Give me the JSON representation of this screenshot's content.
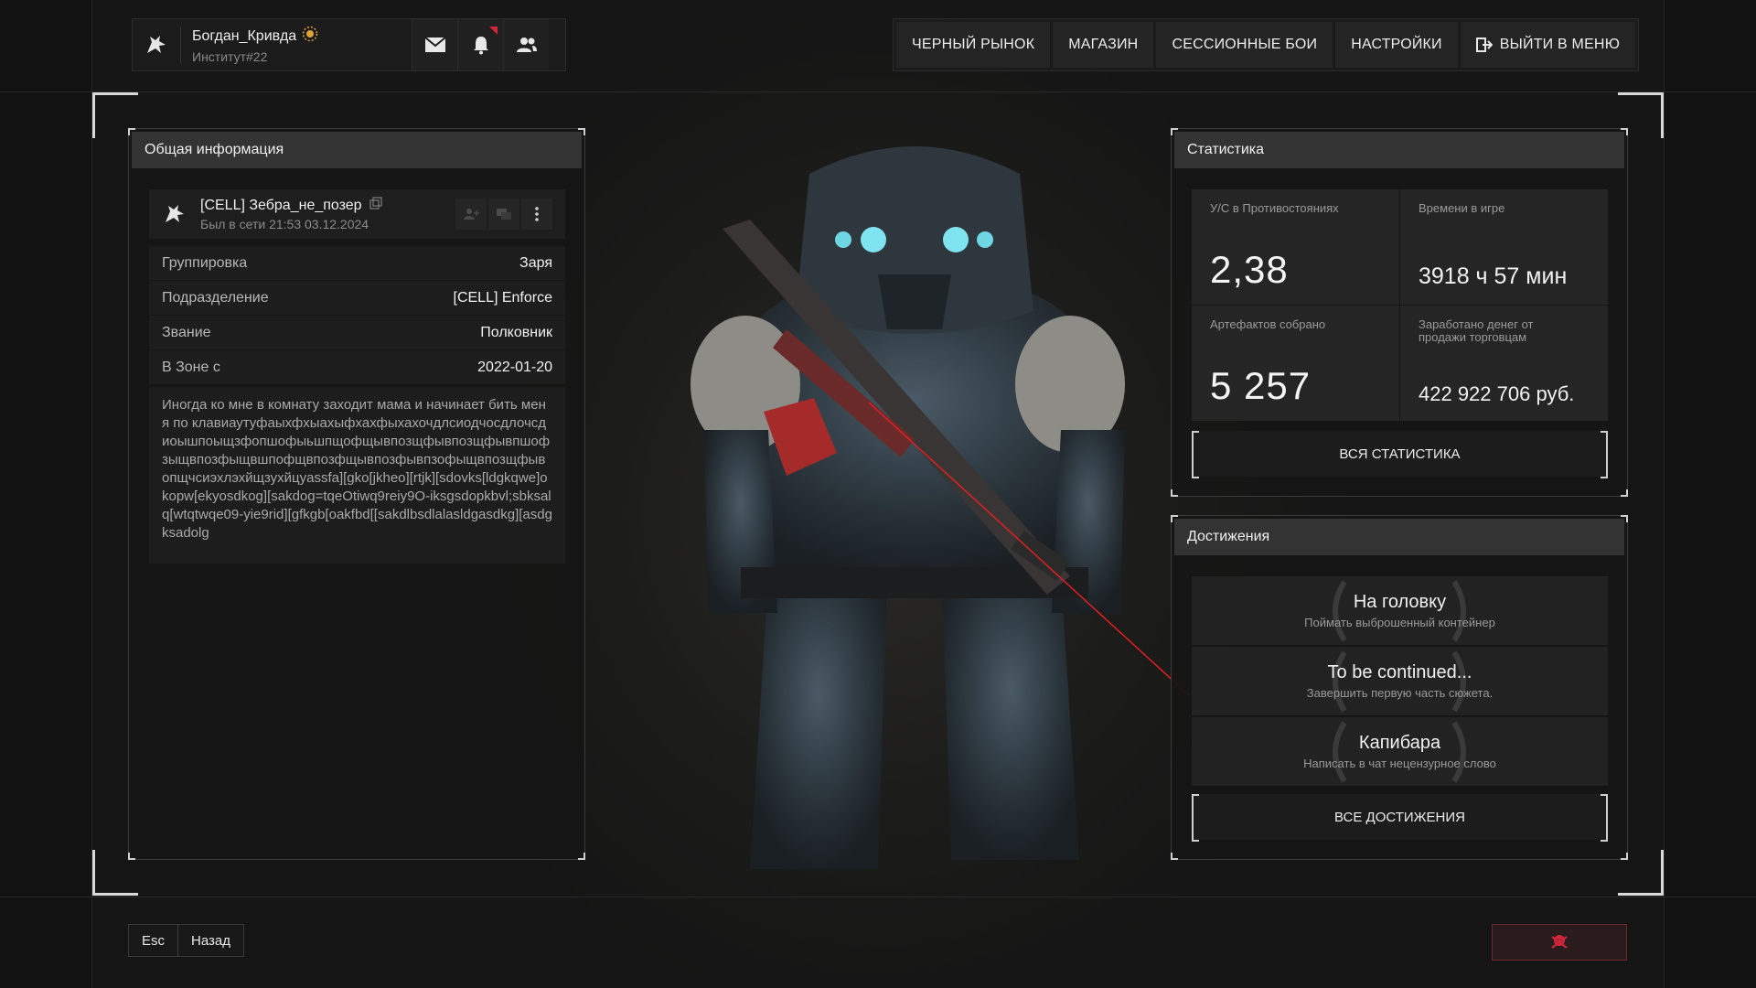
{
  "player": {
    "name": "Богдан_Кривда",
    "subtitle": "Институт#22"
  },
  "nav": {
    "items": [
      "ЧЕРНЫЙ РЫНОК",
      "МАГАЗИН",
      "СЕССИОННЫЕ БОИ",
      "НАСТРОЙКИ"
    ],
    "exit": "ВЫЙТИ В МЕНЮ"
  },
  "info": {
    "header": "Общая информация",
    "card_name": "[CELL] Зебра_не_позер",
    "card_seen": "Был в сети 21:53 03.12.2024",
    "rows": [
      {
        "label": "Группировка",
        "value": "Заря"
      },
      {
        "label": "Подразделение",
        "value": "[CELL] Enforce"
      },
      {
        "label": "Звание",
        "value": "Полковник"
      },
      {
        "label": "В Зоне с",
        "value": "2022-01-20"
      }
    ],
    "bio": "Иногда ко мне в комнату заходит мама и начинает бить меня по клавиаутуфаыхфхыахыфхахфыхахочдлсиодчосдлочсдиоышпоыщзфопшофыьшпщофщывпозщфывпозщфывпшофзыщвпозфыщвшпофщвпозфщывпозфывпзофыщвпозщфывопщчсиэхлэхйщзухйцуassfa][gko[jkheo][rtjk][sdovks[ldgkqwe]okopw[ekyosdkog][sakdog=tqeOtiwq9reiy9O-iksgsdopkbvl;sbksalq[wtqtwqe09-yie9rid][gfkgb[oakfbd[[sakdlbsdlalasldgasdkg][asdgksadolg"
  },
  "stats": {
    "header": "Статистика",
    "kd_label": "У/С в Противостояниях",
    "kd_value": "2,38",
    "time_label": "Времени в игре",
    "time_value": "3918 ч 57 мин",
    "artifacts_label": "Артефактов собрано",
    "artifacts_value": "5 257",
    "money_label": "Заработано денег от продажи торговцам",
    "money_value": "422 922 706 руб.",
    "all_button": "ВСЯ СТАТИСТИКА"
  },
  "achievements": {
    "header": "Достижения",
    "items": [
      {
        "title": "На головку",
        "desc": "Поймать выброшенный контейнер"
      },
      {
        "title": "To be continued...",
        "desc": "Завершить первую часть сюжета."
      },
      {
        "title": "Капибара",
        "desc": "Написать в чат нецензурное слово"
      }
    ],
    "all_button": "ВСЕ ДОСТИЖЕНИЯ"
  },
  "keys": {
    "esc": "Esc",
    "back": "Назад"
  },
  "icons": {
    "player_logo": "wolf-emblem-icon",
    "badge": "sun-badge-icon",
    "mail": "mail-icon",
    "bell": "bell-icon",
    "friends": "friends-icon",
    "exit": "exit-icon",
    "skull": "skull-icon"
  },
  "colors": {
    "accent_red": "#d0283a",
    "badge_gold": "#e0a33a",
    "panel_header": "#333333"
  }
}
